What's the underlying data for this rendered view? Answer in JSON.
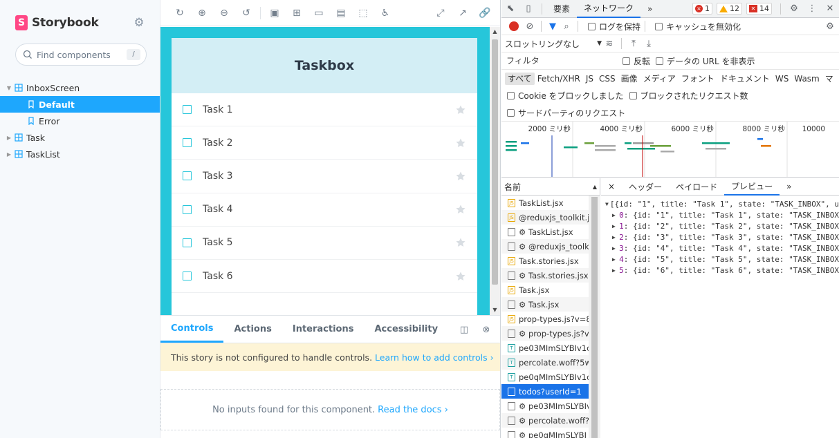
{
  "sidebar": {
    "brand": "Storybook",
    "brand_letter": "S",
    "search_placeholder": "Find components",
    "search_shortcut": "/",
    "tree": [
      {
        "label": "InboxScreen",
        "level": 0,
        "expanded": true
      },
      {
        "label": "Default",
        "level": 1,
        "selected": true
      },
      {
        "label": "Error",
        "level": 1
      },
      {
        "label": "Task",
        "level": 0,
        "expanded": false
      },
      {
        "label": "TaskList",
        "level": 0,
        "expanded": false
      }
    ]
  },
  "preview": {
    "header": "Taskbox",
    "tasks": [
      {
        "title": "Task 1"
      },
      {
        "title": "Task 2"
      },
      {
        "title": "Task 3"
      },
      {
        "title": "Task 4"
      },
      {
        "title": "Task 5"
      },
      {
        "title": "Task 6"
      }
    ]
  },
  "addons": {
    "tabs": [
      "Controls",
      "Actions",
      "Interactions",
      "Accessibility"
    ],
    "active_tab": "Controls",
    "notice_text": "This story is not configured to handle controls.",
    "notice_link": "Learn how to add controls",
    "empty_text": "No inputs found for this component.",
    "empty_link": "Read the docs"
  },
  "devtools": {
    "tabs": [
      "要素",
      "ネットワーク"
    ],
    "active_tab": "ネットワーク",
    "more": "»",
    "errors": "1",
    "warnings": "12",
    "issues": "14",
    "preserve_log": "ログを保持",
    "disable_cache": "キャッシュを無効化",
    "throttling": "スロットリングなし",
    "filter_placeholder": "フィルタ",
    "invert": "反転",
    "hide_data_urls": "データの URL を非表示",
    "types": [
      "すべて",
      "Fetch/XHR",
      "JS",
      "CSS",
      "画像",
      "メディア",
      "フォント",
      "ドキュメント",
      "WS",
      "Wasm",
      "マ"
    ],
    "blocked_cookies": "Cookie をブロックしました",
    "blocked_requests": "ブロックされたリクエスト数",
    "third_party": "サードパーティのリクエスト",
    "timeline_labels": [
      "2000 ミリ秒",
      "4000 ミリ秒",
      "6000 ミリ秒",
      "8000 ミリ秒",
      "10000"
    ],
    "name_header": "名前",
    "requests": [
      {
        "name": "TaskList.jsx",
        "type": "js"
      },
      {
        "name": "@reduxjs_toolkit.js",
        "type": "js"
      },
      {
        "name": "⚙ TaskList.jsx",
        "type": "doc"
      },
      {
        "name": "⚙ @reduxjs_toolkit",
        "type": "doc"
      },
      {
        "name": "Task.stories.jsx",
        "type": "js"
      },
      {
        "name": "⚙ Task.stories.jsx",
        "type": "doc"
      },
      {
        "name": "Task.jsx",
        "type": "js"
      },
      {
        "name": "⚙ Task.jsx",
        "type": "doc"
      },
      {
        "name": "prop-types.js?v=8f",
        "type": "js"
      },
      {
        "name": "⚙ prop-types.js?v=",
        "type": "doc"
      },
      {
        "name": "pe03MImSLYBIv1o.",
        "type": "font"
      },
      {
        "name": "percolate.woff?5w3",
        "type": "font"
      },
      {
        "name": "pe0qMImSLYBIv1o.",
        "type": "font"
      },
      {
        "name": "todos?userId=1",
        "type": "doc",
        "selected": true
      },
      {
        "name": "⚙ pe03MImSLYBIv.",
        "type": "doc"
      },
      {
        "name": "⚙ percolate.woff?5",
        "type": "doc"
      },
      {
        "name": "⚙ pe0qMImSLYBI",
        "type": "doc"
      }
    ],
    "detail_close": "×",
    "detail_tabs": [
      "ヘッダー",
      "ペイロード",
      "プレビュー"
    ],
    "detail_active": "プレビュー",
    "detail_more": "»",
    "preview_root": "[{id: \"1\", title: \"Task 1\", state: \"TASK_INBOX\", u",
    "preview_items": [
      {
        "idx": "0",
        "text": "{id: \"1\", title: \"Task 1\", state: \"TASK_INBOX"
      },
      {
        "idx": "1",
        "text": "{id: \"2\", title: \"Task 2\", state: \"TASK_INBOX"
      },
      {
        "idx": "2",
        "text": "{id: \"3\", title: \"Task 3\", state: \"TASK_INBOX"
      },
      {
        "idx": "3",
        "text": "{id: \"4\", title: \"Task 4\", state: \"TASK_INBOX"
      },
      {
        "idx": "4",
        "text": "{id: \"5\", title: \"Task 5\", state: \"TASK_INBOX"
      },
      {
        "idx": "5",
        "text": "{id: \"6\", title: \"Task 6\", state: \"TASK_INBOX"
      }
    ]
  },
  "colors": {
    "storybook_pink": "#ff4785",
    "storybook_blue": "#1ea7fd",
    "preview_cyan": "#26c6da",
    "devtools_blue": "#1a73e8"
  }
}
